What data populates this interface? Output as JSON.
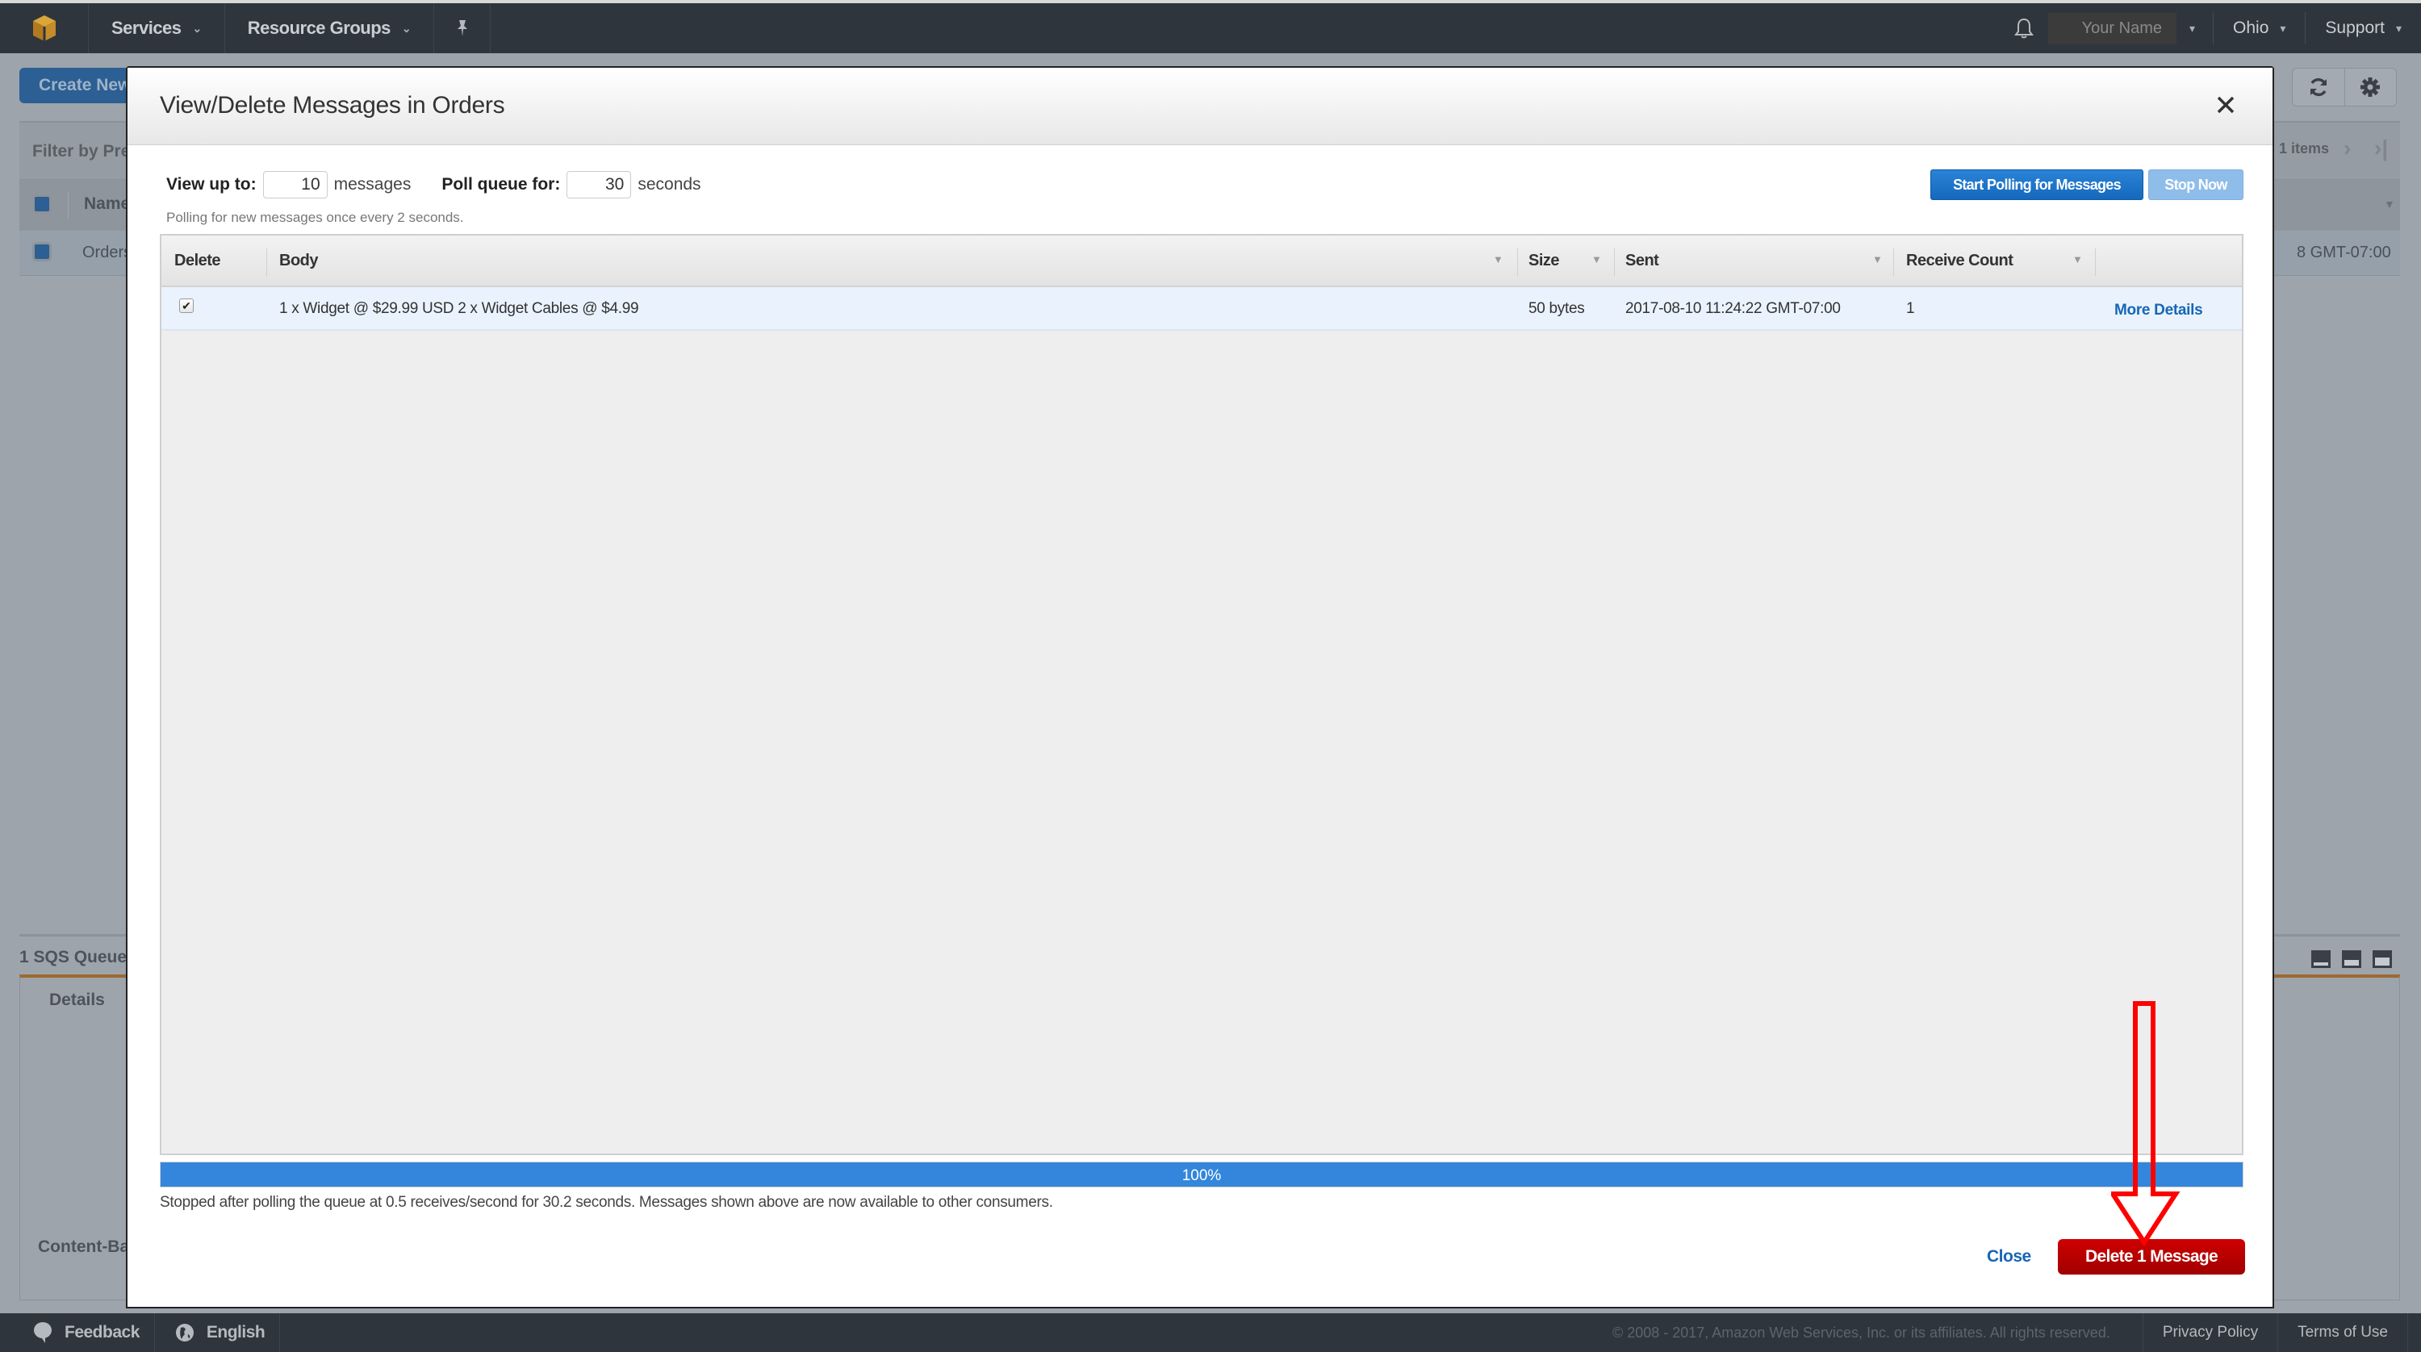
{
  "topnav": {
    "logo_icon": "aws-cube-icon",
    "services_label": "Services",
    "resource_groups_label": "Resource Groups",
    "pin_icon": "pushpin-icon",
    "bell_icon": "bell-icon",
    "user_name": "Your Name",
    "region_label": "Ohio",
    "support_label": "Support"
  },
  "background_page": {
    "create_button_label": "Create New",
    "filter_label": "Filter by Pre",
    "items_label": "1 items",
    "column_name": "Name",
    "row_name": "Orders",
    "row_date_fragment": "8 GMT-07:00",
    "lower_panel_title": "1 SQS Queue",
    "details_tab": "Details",
    "content_based_label": "Content-Ba",
    "refresh_icon": "refresh-icon",
    "settings_icon": "gear-icon"
  },
  "modal": {
    "title": "View/Delete Messages in Orders",
    "close_icon": "close-icon",
    "view_up_to_label": "View up to:",
    "view_up_to_value": "10",
    "view_up_to_unit": "messages",
    "poll_queue_label": "Poll queue for:",
    "poll_queue_value": "30",
    "poll_queue_unit": "seconds",
    "polling_note": "Polling for new messages once every 2 seconds.",
    "start_polling_label": "Start Polling for Messages",
    "stop_now_label": "Stop Now",
    "columns": [
      "Delete",
      "Body",
      "Size",
      "Sent",
      "Receive Count"
    ],
    "rows": [
      {
        "delete_checked": true,
        "body": "1 x Widget @ $29.99 USD 2 x Widget Cables @ $4.99",
        "size": "50 bytes",
        "sent": "2017-08-10 11:24:22 GMT-07:00",
        "receive_count": "1",
        "more_details_label": "More Details"
      }
    ],
    "progress_percent": 100,
    "progress_label": "100%",
    "stopped_message": "Stopped after polling the queue at 0.5 receives/second for 30.2 seconds. Messages shown above are now available to other consumers.",
    "close_label": "Close",
    "delete_label": "Delete 1 Message",
    "delete_button_color": "#b30000"
  },
  "footer": {
    "feedback_label": "Feedback",
    "language_label": "English",
    "copyright": "© 2008 - 2017, Amazon Web Services, Inc. or its affiliates. All rights reserved.",
    "privacy_label": "Privacy Policy",
    "terms_label": "Terms of Use"
  },
  "annotation": {
    "type": "red-down-arrow",
    "color": "#ff0000",
    "points_to": "delete-message-button"
  }
}
